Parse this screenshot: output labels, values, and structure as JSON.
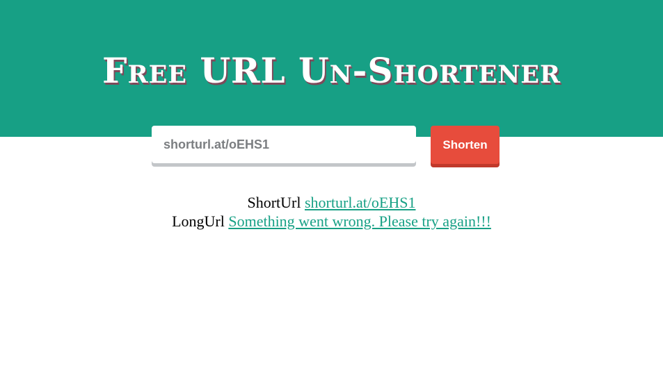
{
  "header": {
    "title": "Free URL Un-Shortener"
  },
  "form": {
    "input_value": "shorturl.at/oEHS1",
    "button_label": "Shorten"
  },
  "result": {
    "short_label": "ShortUrl",
    "short_value": "shorturl.at/oEHS1",
    "long_label": "LongUrl",
    "long_value": "Something went wrong. Please try again!!!"
  },
  "colors": {
    "banner": "#17a085",
    "button": "#e74c3c",
    "link": "#17a085"
  }
}
